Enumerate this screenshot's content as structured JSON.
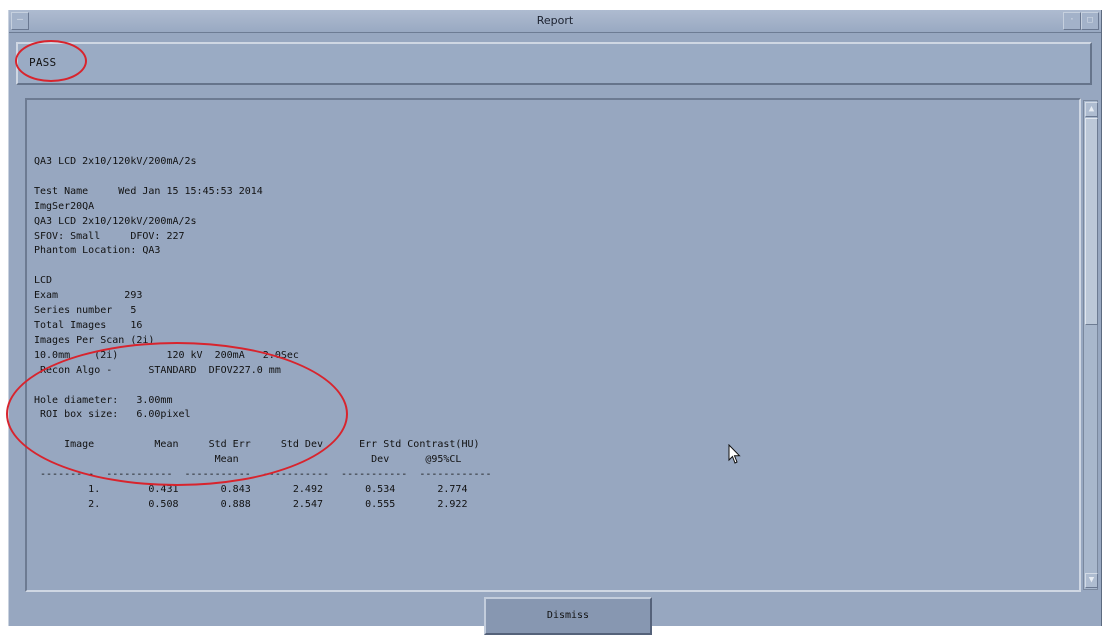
{
  "window": {
    "title": "Report",
    "menu_icon": "dash-icon",
    "controls": [
      "minimize-icon",
      "maximize-icon"
    ]
  },
  "status": {
    "text": "PASS"
  },
  "report": {
    "lines": [
      "QA3 LCD 2x10/120kV/200mA/2s",
      "",
      "Test Name     Wed Jan 15 15:45:53 2014",
      "ImgSer20QA",
      "QA3 LCD 2x10/120kV/200mA/2s",
      "SFOV: Small     DFOV: 227",
      "Phantom Location: QA3",
      "",
      "LCD",
      "Exam           293",
      "Series number   5",
      "Total Images    16",
      "Images Per Scan (2i)",
      "10.0mm    (2i)        120 kV  200mA   2.0Sec",
      " Recon Algo -      STANDARD  DFOV227.0 mm",
      "",
      "Hole diameter:   3.00mm",
      " ROI box size:   6.00pixel",
      "",
      "     Image          Mean     Std Err     Std Dev      Err Std Contrast(HU)",
      "                              Mean                      Dev      @95%CL",
      " ---------  -----------  -----------  -----------  -----------  ------------",
      "         1.        0.431       0.843       2.492       0.534       2.774",
      "         2.        0.508       0.888       2.547       0.555       2.922"
    ]
  },
  "buttons": {
    "dismiss": "Dismiss"
  },
  "annotations": {
    "color": "#d8242d"
  }
}
